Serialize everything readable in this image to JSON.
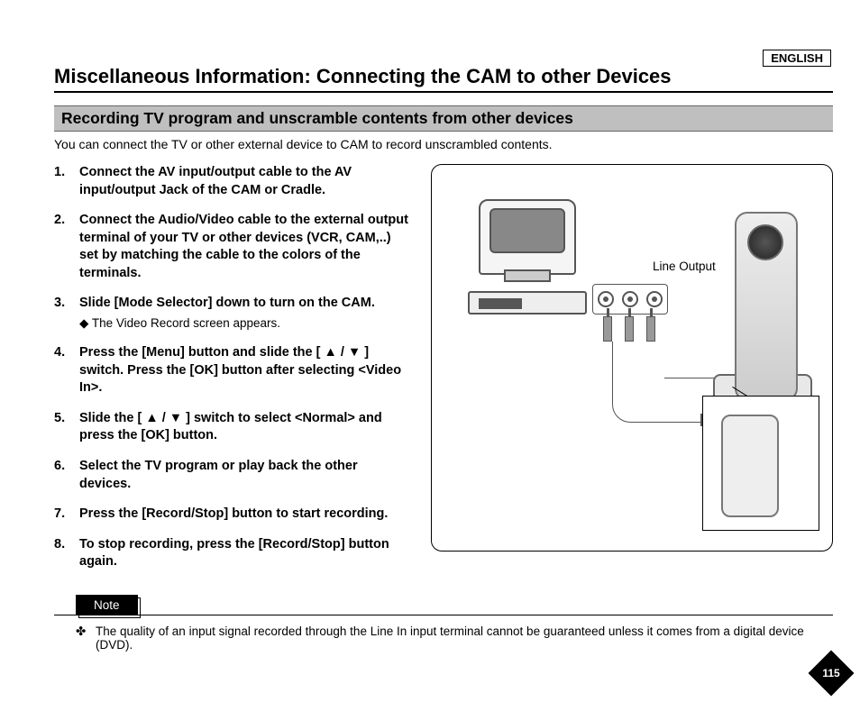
{
  "lang": "ENGLISH",
  "title": "Miscellaneous Information: Connecting the CAM to other Devices",
  "section": "Recording TV program and unscramble contents from other devices",
  "intro": "You can connect the TV or other external device to CAM to record unscrambled contents.",
  "steps": [
    {
      "text": "Connect the AV input/output cable to the AV input/output Jack of the CAM or Cradle."
    },
    {
      "text": "Connect the Audio/Video cable to the external output terminal of your TV or other devices (VCR, CAM,..) set by matching the cable to the colors of the terminals."
    },
    {
      "text": "Slide [Mode Selector] down to turn on the CAM.",
      "sub": "The Video Record screen appears."
    },
    {
      "text": "Press the [Menu] button and slide the [ ▲ / ▼ ] switch. Press the [OK] button after selecting <Video In>."
    },
    {
      "text": "Slide the [ ▲ / ▼ ] switch to select <Normal> and press the [OK] button."
    },
    {
      "text": "Select the TV program or play back the other devices."
    },
    {
      "text": "Press the [Record/Stop] button to start recording."
    },
    {
      "text": "To stop recording, press the [Record/Stop] button again."
    }
  ],
  "diagram": {
    "label": "Line Output"
  },
  "note_label": "Note",
  "note": "The quality of an input signal recorded through the Line In input terminal cannot be guaranteed unless it comes from a digital device (DVD).",
  "page": "115"
}
